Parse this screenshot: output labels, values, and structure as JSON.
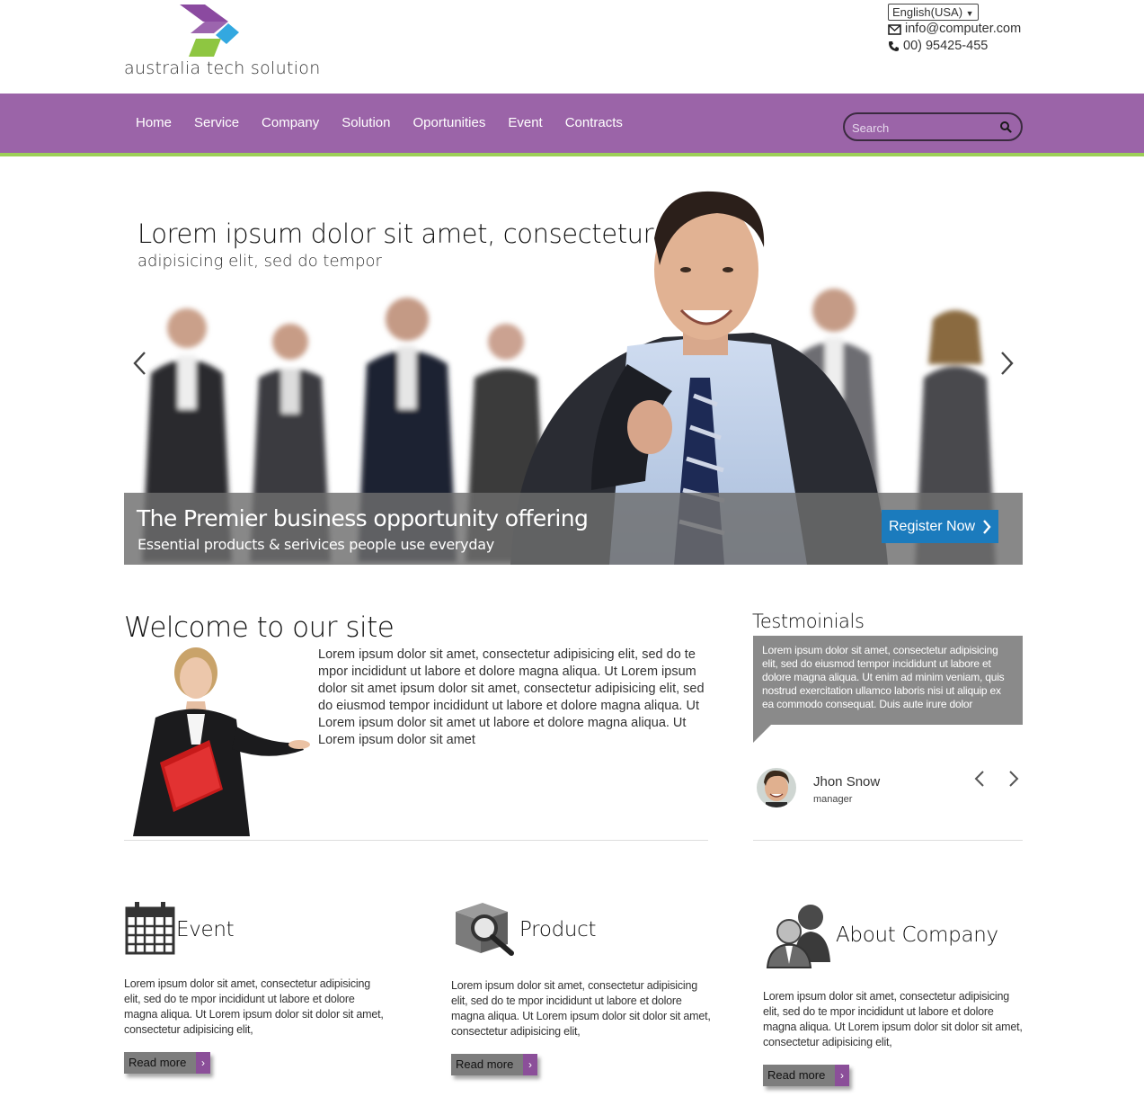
{
  "brand": {
    "name": "australia tech solution",
    "colors": {
      "purple": "#9b64a8",
      "green": "#9ccf57",
      "blue": "#1b7bbd"
    }
  },
  "topbar": {
    "language": "English(USA)",
    "email": "info@computer.com",
    "phone": "00) 95425-455",
    "email_icon": "envelope-icon",
    "phone_icon": "phone-icon"
  },
  "nav": {
    "items": [
      "Home",
      "Service",
      "Company",
      "Solution",
      "Oportunities",
      "Event",
      "Contracts"
    ],
    "search_placeholder": "Search"
  },
  "hero": {
    "title": "Lorem ipsum dolor sit amet, consectetur",
    "subtitle": "adipisicing elit, sed do tempor",
    "band_title": "The Premier business opportunity offering",
    "band_subtitle": "Essential products & serivices people use everyday",
    "cta_label": "Register Now"
  },
  "welcome": {
    "heading": "Welcome to our site",
    "text": "Lorem ipsum dolor sit amet, consectetur adipisicing elit, sed do te mpor incididunt ut labore et dolore magna aliqua. Ut Lorem ipsum dolor sit amet ipsum dolor sit amet, consectetur adipisicing elit, sed do eiusmod tempor incididunt ut labore et dolore magna aliqua. Ut Lorem ipsum dolor sit amet ut labore et dolore magna aliqua. Ut Lorem ipsum dolor sit amet"
  },
  "testimonials": {
    "heading": "Testmoinials",
    "quote": "Lorem ipsum dolor sit amet, consectetur adipisicing elit, sed do eiusmod tempor incididunt ut labore et dolore magna aliqua. Ut enim ad minim veniam, quis nostrud exercitation ullamco laboris nisi ut aliquip ex ea commodo consequat. Duis aute irure dolor",
    "name": "Jhon Snow",
    "role": "manager"
  },
  "features": [
    {
      "icon": "calendar-icon",
      "title": "Event",
      "text": "Lorem ipsum dolor sit amet, consectetur adipisicing elit, sed do te mpor incididunt ut labore et dolore magna aliqua. Ut Lorem ipsum dolor sit dolor sit amet, consectetur adipisicing elit,",
      "button": "Read more"
    },
    {
      "icon": "product-search-icon",
      "title": "Product",
      "text": "Lorem ipsum dolor sit amet, consectetur adipisicing elit, sed do te mpor incididunt ut labore et dolore magna aliqua. Ut Lorem ipsum dolor sit dolor sit amet, consectetur adipisicing elit,",
      "button": "Read more"
    },
    {
      "icon": "people-icon",
      "title": "About Company",
      "text": "Lorem ipsum dolor sit amet, consectetur adipisicing elit, sed do te mpor incididunt ut labore et dolore magna aliqua. Ut Lorem ipsum dolor sit dolor sit amet, consectetur adipisicing elit,",
      "button": "Read more"
    }
  ]
}
